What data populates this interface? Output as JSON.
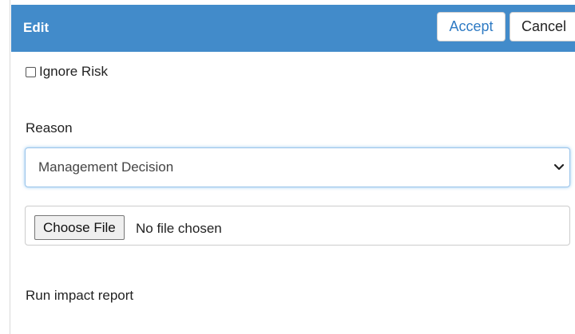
{
  "header": {
    "title": "Edit",
    "accept_label": "Accept",
    "cancel_label": "Cancel",
    "bg_color": "#428bca"
  },
  "ignore_risk": {
    "label": "Ignore Risk",
    "checked": false
  },
  "reason": {
    "label": "Reason",
    "selected": "Management Decision"
  },
  "file_input": {
    "button_label": "Choose File",
    "status": "No file chosen"
  },
  "impact_report": {
    "label": "Run impact report"
  }
}
